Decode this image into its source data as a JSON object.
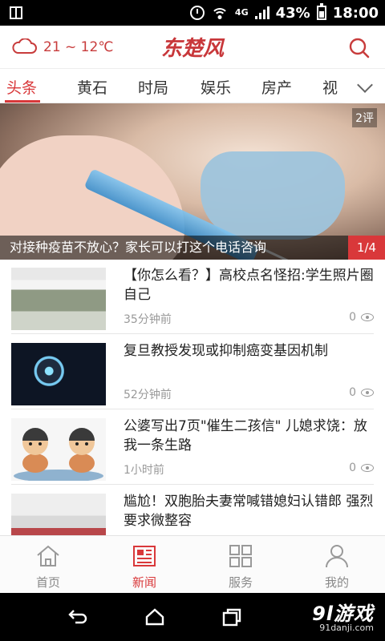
{
  "status_bar": {
    "network": "4G",
    "battery": "43%",
    "time": "18:00"
  },
  "header": {
    "weather": "21 ~ 12℃",
    "brand": "东楚风"
  },
  "tabs": [
    {
      "label": "头条",
      "active": true
    },
    {
      "label": "黄石",
      "active": false
    },
    {
      "label": "时局",
      "active": false
    },
    {
      "label": "娱乐",
      "active": false
    },
    {
      "label": "房产",
      "active": false
    },
    {
      "label": "视",
      "active": false
    }
  ],
  "hero": {
    "caption": "对接种疫苗不放心？家长可以打这个电话咨询",
    "comments": "2评",
    "pager": "1/4"
  },
  "news": [
    {
      "title": "【你怎么看？】高校点名怪招:学生照片圈自己",
      "time": "35分钟前",
      "views": "0"
    },
    {
      "title": "复旦教授发现或抑制癌变基因机制",
      "time": "52分钟前",
      "views": "0"
    },
    {
      "title": "公婆写出7页\"催生二孩信\" 儿媳求饶：放我一条生路",
      "time": "1小时前",
      "views": "0"
    },
    {
      "title": "尴尬！双胞胎夫妻常喊错媳妇认错郎 强烈要求微整容",
      "time": "",
      "views": ""
    }
  ],
  "bottom_nav": [
    {
      "label": "首页",
      "active": false
    },
    {
      "label": "新闻",
      "active": true
    },
    {
      "label": "服务",
      "active": false
    },
    {
      "label": "我的",
      "active": false
    }
  ],
  "watermark": {
    "big": "9l游戏",
    "small": "91danji.com"
  },
  "colors": {
    "accent": "#d9383a",
    "text": "#222222",
    "muted": "#999999"
  }
}
